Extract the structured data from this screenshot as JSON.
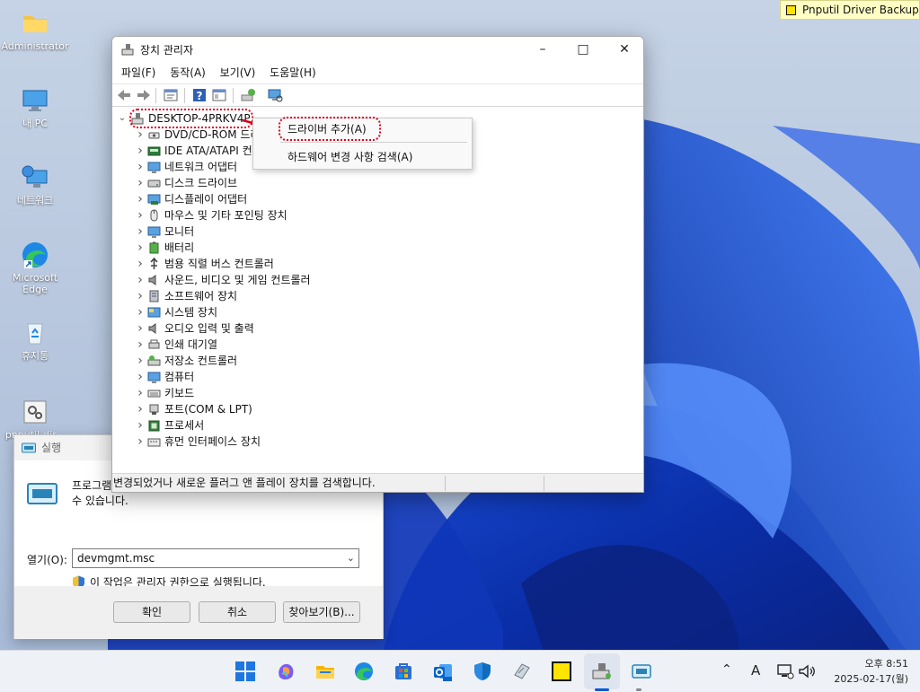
{
  "notification": {
    "text": "Pnputil Driver Backup"
  },
  "desktop": {
    "icons": [
      {
        "label": "Administrator",
        "icon": "folder-icon"
      },
      {
        "label": "내 PC",
        "icon": "monitor-icon"
      },
      {
        "label": "네트워크",
        "icon": "network-icon"
      },
      {
        "label": "Microsoft Edge",
        "icon": "edge-icon"
      },
      {
        "label": "휴지통",
        "icon": "recycle-bin-icon"
      },
      {
        "label": "pnputil-dir...",
        "icon": "gear-file-icon"
      }
    ]
  },
  "run_dialog": {
    "title": "실행",
    "description": "프로그램, 폴더, 문서 또는 인터넷 주소를 입력하여 해당 항목을 열 수 있습니다.",
    "open_label": "열기(O):",
    "input_value": "devmgmt.msc",
    "admin_note": "이 작업은 관리자 권한으로 실행됩니다.",
    "ok_label": "확인",
    "cancel_label": "취소",
    "browse_label": "찾아보기(B)..."
  },
  "device_manager": {
    "title": "장치 관리자",
    "menu": [
      "파일(F)",
      "동작(A)",
      "보기(V)",
      "도움말(H)"
    ],
    "root": "DESKTOP-4PRKV4P",
    "categories": [
      "DVD/CD-ROM 드라이브",
      "IDE ATA/ATAPI 컨트롤러",
      "네트워크 어댑터",
      "디스크 드라이브",
      "디스플레이 어댑터",
      "마우스 및 기타 포인팅 장치",
      "모니터",
      "배터리",
      "범용 직렬 버스 컨트롤러",
      "사운드, 비디오 및 게임 컨트롤러",
      "소프트웨어 장치",
      "시스템 장치",
      "오디오 입력 및 출력",
      "인쇄 대기열",
      "저장소 컨트롤러",
      "컴퓨터",
      "키보드",
      "포트(COM & LPT)",
      "프로세서",
      "휴먼 인터페이스 장치"
    ],
    "status": "변경되었거나 새로운 플러그 앤 플레이 장치를 검색합니다."
  },
  "context_menu": {
    "items": [
      "드라이버 추가(A)",
      "하드웨어 변경 사항 검색(A)"
    ]
  },
  "clock": {
    "time": "오후 8:51",
    "date": "2025-02-17(월)"
  },
  "tray": {
    "ime": "A"
  },
  "colors": {
    "accent": "#0a5ad4",
    "highlight": "#e0001a"
  }
}
